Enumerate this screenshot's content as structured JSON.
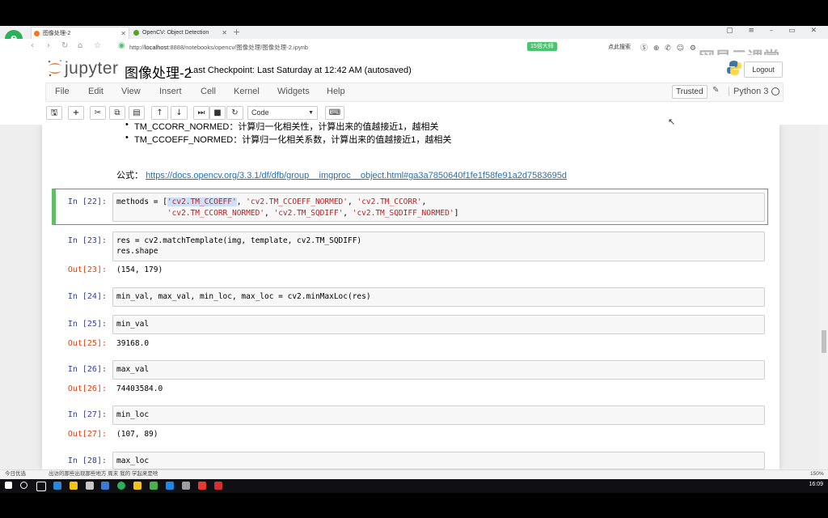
{
  "browser": {
    "tabs": [
      {
        "title": "图像处理-2",
        "active": true
      },
      {
        "title": "OpenCV: Object Detection",
        "active": false
      }
    ],
    "url_host": "localhost",
    "url_rest": ":8888/notebooks/opencv/图像处理/图像处理-2.ipynb",
    "badge": "15倍大师",
    "search_label": "点此搜索",
    "watermark": "网易云课堂"
  },
  "jupyter": {
    "logo_text": "jupyter",
    "notebook_name": "图像处理-2",
    "checkpoint": "Last Checkpoint: Last Saturday at 12:42 AM (autosaved)",
    "logout": "Logout",
    "menu": [
      "File",
      "Edit",
      "View",
      "Insert",
      "Cell",
      "Kernel",
      "Widgets",
      "Help"
    ],
    "trusted": "Trusted",
    "kernel": "Python 3",
    "cell_type": "Code"
  },
  "notebook": {
    "bullets": [
      "TM_CCORR_NORMED：计算归一化相关性，计算出来的值越接近1，越相关",
      "TM_CCOEFF_NORMED：计算归一化相关系数，计算出来的值越接近1，越相关"
    ],
    "formula_label": "公式：",
    "formula_link": "https://docs.opencv.org/3.3.1/df/dfb/group__imgproc__object.html#ga3a7850640f1fe1f58fe91a2d7583695d",
    "cells": [
      {
        "in": "In [22]:",
        "lines": [
          "methods = ['cv2.TM_CCOEFF', 'cv2.TM_CCOEFF_NORMED', 'cv2.TM_CCORR',",
          "           'cv2.TM_CCORR_NORMED', 'cv2.TM_SQDIFF', 'cv2.TM_SQDIFF_NORMED']"
        ]
      },
      {
        "in": "In [23]:",
        "lines": [
          "res = cv2.matchTemplate(img, template, cv2.TM_SQDIFF)",
          "res.shape"
        ],
        "out": "Out[23]:",
        "output": "(154, 179)"
      },
      {
        "in": "In [24]:",
        "lines": [
          "min_val, max_val, min_loc, max_loc = cv2.minMaxLoc(res)"
        ]
      },
      {
        "in": "In [25]:",
        "lines": [
          "min_val"
        ],
        "out": "Out[25]:",
        "output": "39168.0"
      },
      {
        "in": "In [26]:",
        "lines": [
          "max_val"
        ],
        "out": "Out[26]:",
        "output": "74403584.0"
      },
      {
        "in": "In [27]:",
        "lines": [
          "min_loc"
        ],
        "out": "Out[27]:",
        "output": "(107, 89)"
      },
      {
        "in": "In [28]:",
        "lines": [
          "max_loc"
        ]
      }
    ]
  },
  "statusbar": {
    "left": "今日优选",
    "news": "出访的那些出现那些地方 周末 我的 学起来是啥",
    "right": "150%"
  },
  "taskbar": {
    "clock": "16:09"
  }
}
